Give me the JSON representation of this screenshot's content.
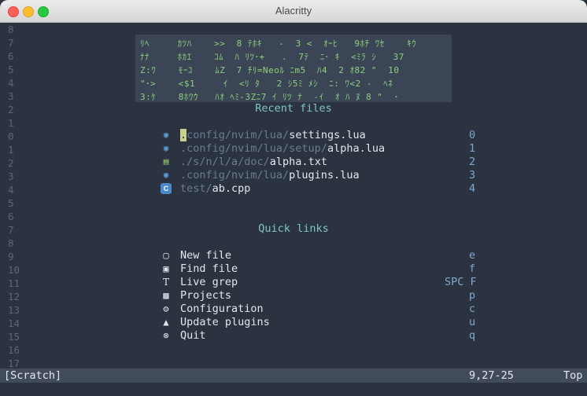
{
  "window": {
    "title": "Alacritty"
  },
  "line_numbers": [
    "8",
    "7",
    "6",
    "5",
    "4",
    "3",
    "2",
    "1",
    "0",
    "1",
    "2",
    "3",
    "4",
    "5",
    "6",
    "7",
    "8",
    "9",
    "10",
    "11",
    "12",
    "13",
    "14",
    "15",
    "16",
    "17"
  ],
  "banner": {
    "rows": [
      "ﾘﾍ     ｶﾂﾊ    >>  8 ﾃﾎｷ   -  3 <  ｵｰﾋ   9ﾎﾁ ﾜｾ    ｷｳ",
      "ﾅﾅ     ﾎｶｴ    ｺﾑ  ﾊ ﾘﾂ･+   .  7ﾃ  ﾆ･ ｷ  <ﾐﾗ ｼ   37",
      "Z:ﾜ    ﾓｰｺ    ﾑZ  7 ﾁﾘ=Neoﾙ ﾆm5  ﾊ4  2 ｵ82 \"  10",
      "\"･>    <$1     ｲ  <ﾘ ﾀ   2 ｼ5ﾐ ﾒｼ  ﾆ: ﾜ<2 -  ﾍﾈ",
      "3:ｹ    8ﾎﾜｳ   ﾊｵ ﾍﾐ-3Zﾆ7 ｲ ﾘﾂ ﾅ  -ｲ  ｵ ﾊ ﾇ 8 \"  ･"
    ]
  },
  "recent_files": {
    "heading": "Recent files",
    "items": [
      {
        "dir": ".config/nvim/lua/",
        "name": "settings.lua",
        "key": "0",
        "icon": "lua-icon"
      },
      {
        "dir": ".config/nvim/lua/setup/",
        "name": "alpha.lua",
        "key": "1",
        "icon": "lua-icon"
      },
      {
        "dir": "./s/n/l/a/doc/",
        "name": "alpha.txt",
        "key": "2",
        "icon": "text-file-icon"
      },
      {
        "dir": ".config/nvim/lua/",
        "name": "plugins.lua",
        "key": "3",
        "icon": "lua-icon"
      },
      {
        "dir": "test/",
        "name": "ab.cpp",
        "key": "4",
        "icon": "cpp-icon"
      }
    ]
  },
  "quick_links": {
    "heading": "Quick links",
    "items": [
      {
        "label": "New file",
        "key": "e",
        "icon": "new-file-icon"
      },
      {
        "label": "Find file",
        "key": "f",
        "icon": "find-file-icon"
      },
      {
        "label": "Live grep",
        "key": "SPC F",
        "icon": "text-search-icon"
      },
      {
        "label": "Projects",
        "key": "p",
        "icon": "folder-icon"
      },
      {
        "label": "Configuration",
        "key": "c",
        "icon": "gear-icon"
      },
      {
        "label": "Update plugins",
        "key": "u",
        "icon": "update-icon"
      },
      {
        "label": "Quit",
        "key": "q",
        "icon": "quit-icon"
      }
    ]
  },
  "statusline": {
    "buffer": "[Scratch]",
    "position": "9,27-25",
    "scroll": "Top"
  },
  "colors": {
    "background": "#2b3340",
    "accent": "#7dc6c6",
    "key": "#7fa7d0",
    "matrix_green": "#89d27a"
  }
}
